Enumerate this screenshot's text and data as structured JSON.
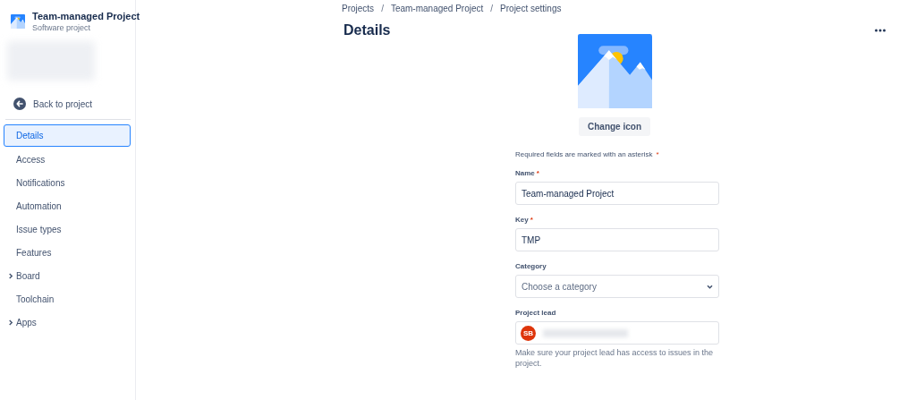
{
  "sidebar": {
    "project": {
      "title": "Team-managed Project",
      "subtitle": "Software project"
    },
    "back_link": "Back to project",
    "items": [
      {
        "label": "Details",
        "selected": true,
        "expandable": false
      },
      {
        "label": "Access",
        "selected": false,
        "expandable": false
      },
      {
        "label": "Notifications",
        "selected": false,
        "expandable": false
      },
      {
        "label": "Automation",
        "selected": false,
        "expandable": false
      },
      {
        "label": "Issue types",
        "selected": false,
        "expandable": false
      },
      {
        "label": "Features",
        "selected": false,
        "expandable": false
      },
      {
        "label": "Board",
        "selected": false,
        "expandable": true
      },
      {
        "label": "Toolchain",
        "selected": false,
        "expandable": false
      },
      {
        "label": "Apps",
        "selected": false,
        "expandable": true
      }
    ]
  },
  "breadcrumbs": [
    "Projects",
    "Team-managed Project",
    "Project settings"
  ],
  "breadcrumb_separator": "/",
  "page_title": "Details",
  "change_icon_button": "Change icon",
  "required_note": "Required fields are marked with an asterisk",
  "required_note_mark": "*",
  "fields": [
    {
      "kind": "text",
      "label": "Name",
      "asterisk": "*",
      "value": "Team-managed Project"
    },
    {
      "kind": "text",
      "label": "Key",
      "asterisk": "*",
      "value": "TMP"
    },
    {
      "kind": "select",
      "label": "Category",
      "placeholder": "Choose a category"
    },
    {
      "kind": "user",
      "label": "Project lead",
      "initials": "SB",
      "help": "Make sure your project lead has access to issues in the project."
    }
  ]
}
